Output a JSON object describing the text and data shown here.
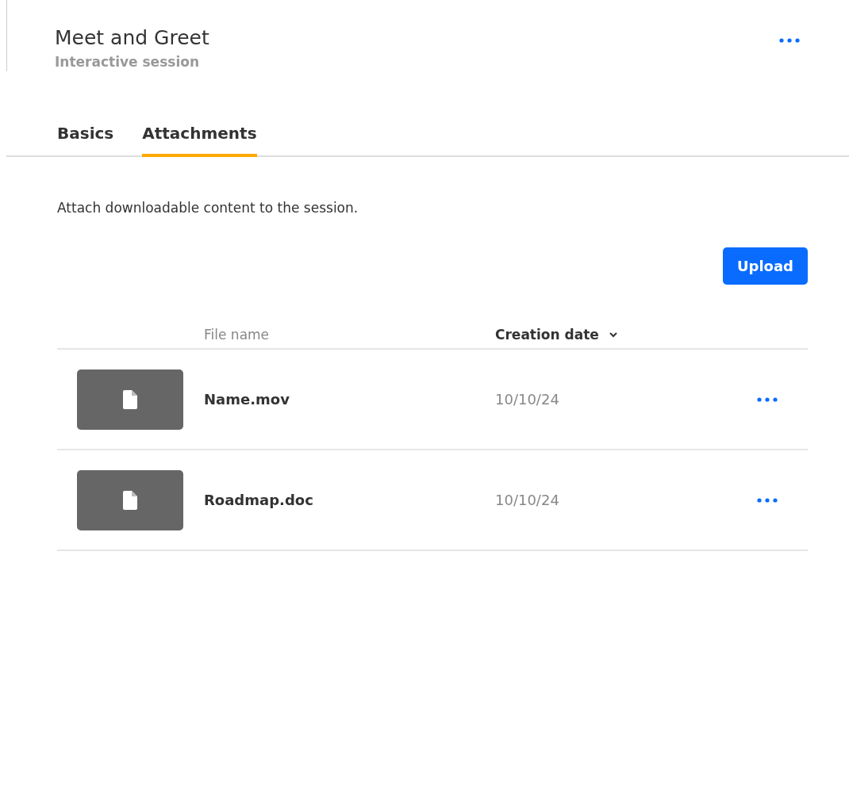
{
  "header": {
    "title": "Meet and Greet",
    "subtitle": "Interactive session"
  },
  "tabs": [
    {
      "label": "Basics",
      "selected": false
    },
    {
      "label": "Attachments",
      "selected": true
    }
  ],
  "description": "Attach downloadable content to the session.",
  "upload_button": "Upload",
  "table": {
    "columns": [
      {
        "label": "File name",
        "sorted": false
      },
      {
        "label": "Creation date",
        "sorted": true
      }
    ],
    "rows": [
      {
        "file_name": "Name.mov",
        "creation_date": "10/10/24"
      },
      {
        "file_name": "Roadmap.doc",
        "creation_date": "10/10/24"
      }
    ]
  }
}
